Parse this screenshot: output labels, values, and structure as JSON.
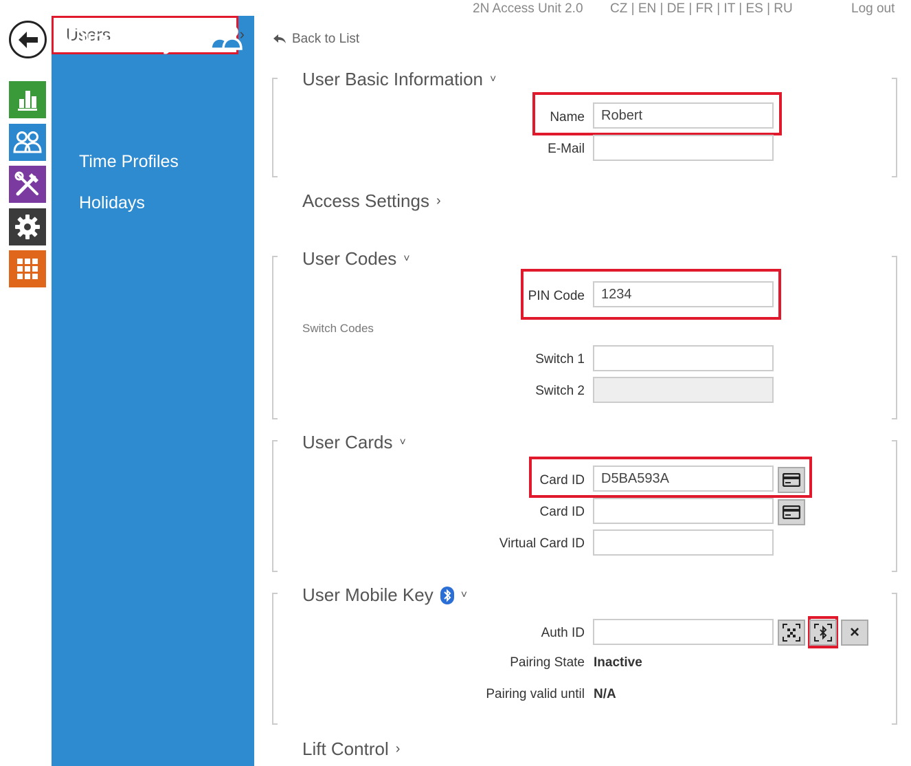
{
  "app": {
    "product": "2N Access Unit 2.0",
    "languages": "CZ | EN | DE | FR | IT | ES | RU",
    "logout": "Log out"
  },
  "panel": {
    "title": "Directory",
    "items": [
      "Users",
      "Time Profiles",
      "Holidays"
    ]
  },
  "back_to_list": "Back to List",
  "sections": {
    "basic": {
      "title": "User Basic Information",
      "name_label": "Name",
      "name_value": "Robert",
      "email_label": "E-Mail",
      "email_value": ""
    },
    "access": {
      "title": "Access Settings"
    },
    "codes": {
      "title": "User Codes",
      "pin_label": "PIN Code",
      "pin_value": "1234",
      "switch_codes": "Switch Codes",
      "switch1_label": "Switch 1",
      "switch1_value": "",
      "switch2_label": "Switch 2",
      "switch2_value": ""
    },
    "cards": {
      "title": "User Cards",
      "card1_label": "Card ID",
      "card1_value": "D5BA593A",
      "card2_label": "Card ID",
      "card2_value": "",
      "virtual_label": "Virtual Card ID",
      "virtual_value": ""
    },
    "mobile": {
      "title": "User Mobile Key",
      "auth_label": "Auth ID",
      "auth_value": "",
      "pairing_state_label": "Pairing State",
      "pairing_state_value": "Inactive",
      "pairing_valid_label": "Pairing valid until",
      "pairing_valid_value": "N/A",
      "clear_symbol": "×"
    },
    "lift": {
      "title": "Lift Control"
    }
  },
  "colors": {
    "panel_blue": "#2f8bd0",
    "highlight_red": "#e0192c",
    "status_green": "#3a9a3a",
    "directory_blue": "#2b88cf",
    "hardware_purple": "#7b3aa0",
    "system_dark": "#3b3b3b",
    "services_orange": "#e0661c"
  }
}
